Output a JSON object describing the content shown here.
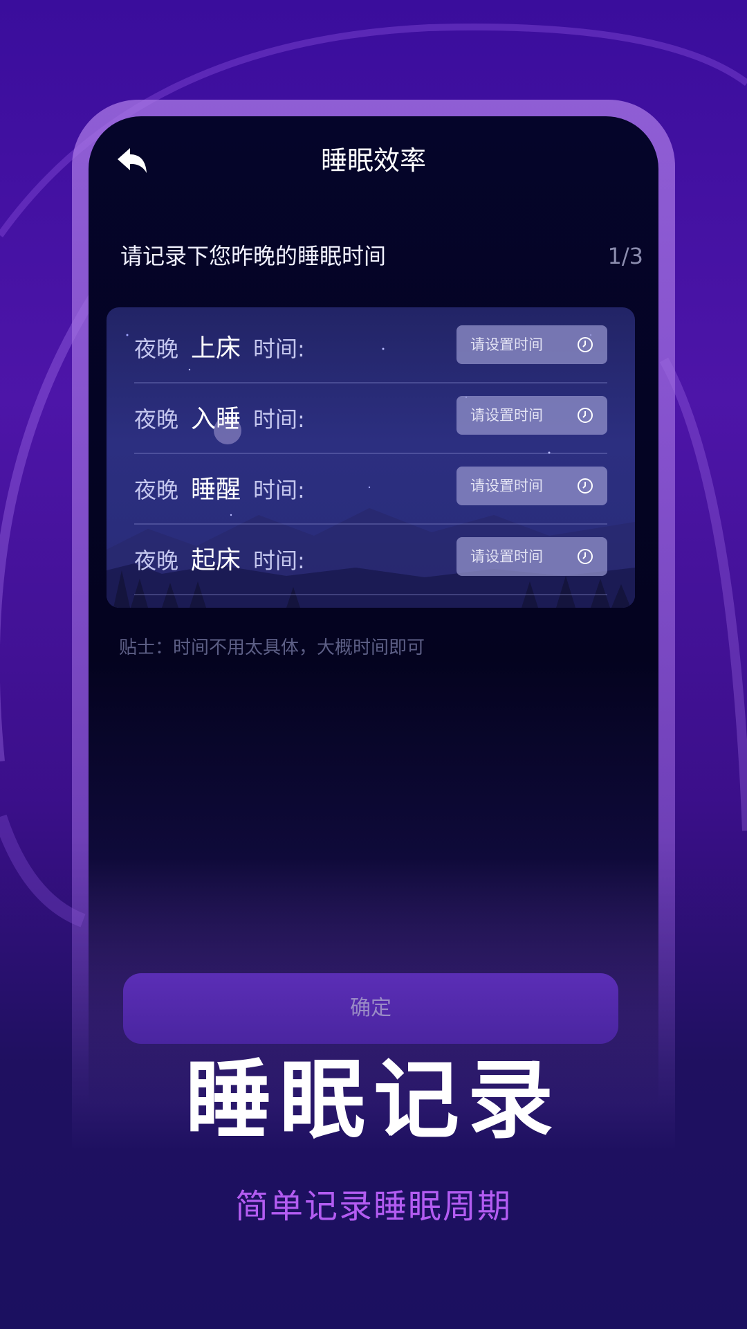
{
  "colors": {
    "background": "#3a0d9c",
    "screen": "#04031f",
    "card": "#2a2d7c",
    "accent_button": "#5b2eb6",
    "subheading": "#b35cf2"
  },
  "header": {
    "back_icon": "back-arrow-icon",
    "title": "睡眠效率"
  },
  "prompt": {
    "text": "请记录下您昨晚的睡眠时间",
    "step": "1/3"
  },
  "rows": [
    {
      "prefix": "夜晚",
      "key": "上床",
      "suffix": "时间:",
      "placeholder": "请设置时间",
      "icon": "clock-icon"
    },
    {
      "prefix": "夜晚",
      "key": "入睡",
      "suffix": "时间:",
      "placeholder": "请设置时间",
      "icon": "clock-icon"
    },
    {
      "prefix": "夜晚",
      "key": "睡醒",
      "suffix": "时间:",
      "placeholder": "请设置时间",
      "icon": "clock-icon"
    },
    {
      "prefix": "夜晚",
      "key": "起床",
      "suffix": "时间:",
      "placeholder": "请设置时间",
      "icon": "clock-icon"
    }
  ],
  "tip": "贴士：时间不用太具体，大概时间即可",
  "confirm_label": "确定",
  "promo": {
    "headline": "睡眠记录",
    "subheading": "简单记录睡眠周期"
  }
}
